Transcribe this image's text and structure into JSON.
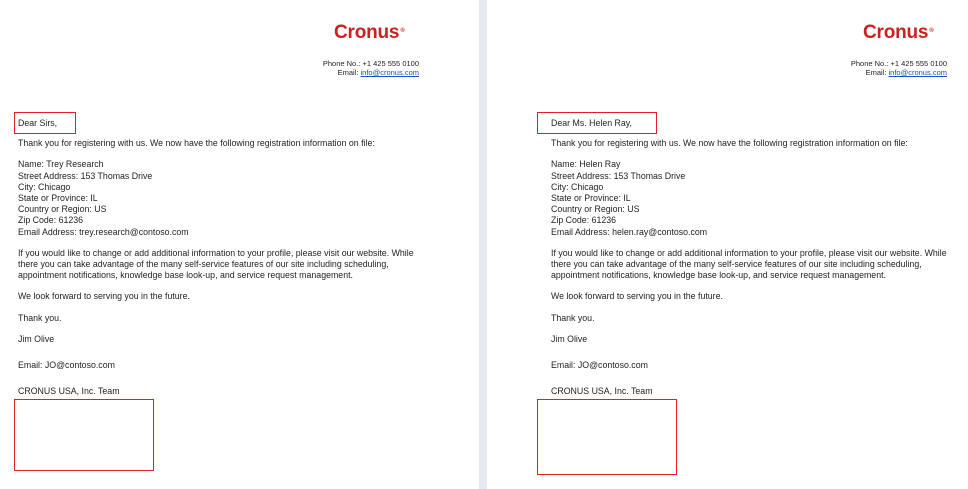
{
  "divider": "",
  "letters": [
    {
      "logo": "Cronus",
      "logo_mark": "®",
      "phone": "Phone No.: +1 425 555 0100",
      "email_label": "Email: ",
      "email_link": "info@cronus.com",
      "salutation": "Dear Sirs,",
      "intro": "Thank you for registering with us. We now have the following registration information on file:",
      "fields": [
        "Name: Trey Research",
        "Street Address: 153 Thomas Drive",
        "City: Chicago",
        "State or Province: IL",
        "Country or Region: US",
        "Zip Code: 61236",
        "Email Address: trey.research@contoso.com"
      ],
      "paragraph": "If you would like to change or add additional information to your profile, please visit our website. While there you can take advantage of the many self-service features of our site including scheduling, appointment notifications, knowledge base look-up, and service request management.",
      "closing1": "We look forward to serving you in the future.",
      "closing2": "Thank you.",
      "signature": [
        "Jim Olive",
        "Email: JO@contoso.com",
        "CRONUS USA, Inc. Team"
      ]
    },
    {
      "logo": "Cronus",
      "logo_mark": "®",
      "phone": "Phone No.: +1 425 555 0100",
      "email_label": "Email: ",
      "email_link": "info@cronus.com",
      "salutation": "Dear Ms. Helen Ray,",
      "intro": "Thank you for registering with us. We now have the following registration information on file:",
      "fields": [
        "Name: Helen Ray",
        "Street Address: 153 Thomas Drive",
        "City: Chicago",
        "State or Province: IL",
        "Country or Region: US",
        "Zip Code: 61236",
        "Email Address: helen.ray@contoso.com"
      ],
      "paragraph": "If you would like to change or add additional information to your profile, please visit our website. While there you can take advantage of the many self-service features of our site including scheduling, appointment notifications, knowledge base look-up, and service request management.",
      "closing1": "We look forward to serving you in the future.",
      "closing2": "Thank you.",
      "signature": [
        "Jim Olive",
        "Email: JO@contoso.com",
        "CRONUS USA, Inc. Team"
      ]
    }
  ],
  "highlight_color": "#e02026",
  "brand_color": "#c8211f",
  "link_color": "#1a4fc9"
}
